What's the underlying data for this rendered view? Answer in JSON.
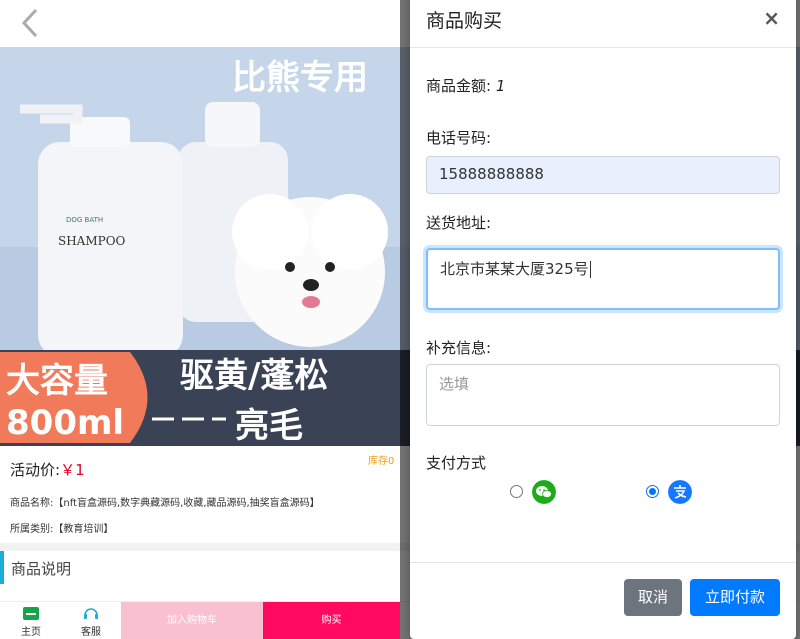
{
  "product": {
    "banner_top_text": "比熊专用",
    "banner_badge_line1": "大容量",
    "banner_badge_line2": "800ml",
    "banner_slogan1": "驱黄/蓬松",
    "banner_slogan2": "亮毛",
    "bottle_label": "SHAMPOO",
    "bottle_label_small": "DOG BATH",
    "price_label": "活动价:",
    "price_value": "￥1",
    "stock_label": "库存0",
    "name_line": "商品名称:【nft盲盒源码,数字典藏源码,收藏,藏品源码,抽奖盲盒源码】",
    "category_line": "所属类别:【教育培训】",
    "section_title": "商品说明"
  },
  "bottom_bar": {
    "home_label": "主页",
    "service_label": "客服",
    "cart_label": "加入购物车",
    "buy_label": "购买"
  },
  "modal": {
    "title": "商品购买",
    "close_symbol": "×",
    "amount_label": "商品金额:",
    "amount_value": "1",
    "phone_label": "电话号码:",
    "phone_value": "15888888888",
    "address_label": "送货地址:",
    "address_value": "北京市某某大厦325号",
    "extra_label": "补充信息:",
    "extra_placeholder": "选填",
    "pay_label": "支付方式",
    "pay_options": [
      {
        "icon": "wechat-pay-icon",
        "selected": false,
        "color": "#1aad19"
      },
      {
        "icon": "alipay-icon",
        "selected": true,
        "color": "#1677ff"
      }
    ],
    "cancel_label": "取消",
    "pay_button_label": "立即付款"
  }
}
